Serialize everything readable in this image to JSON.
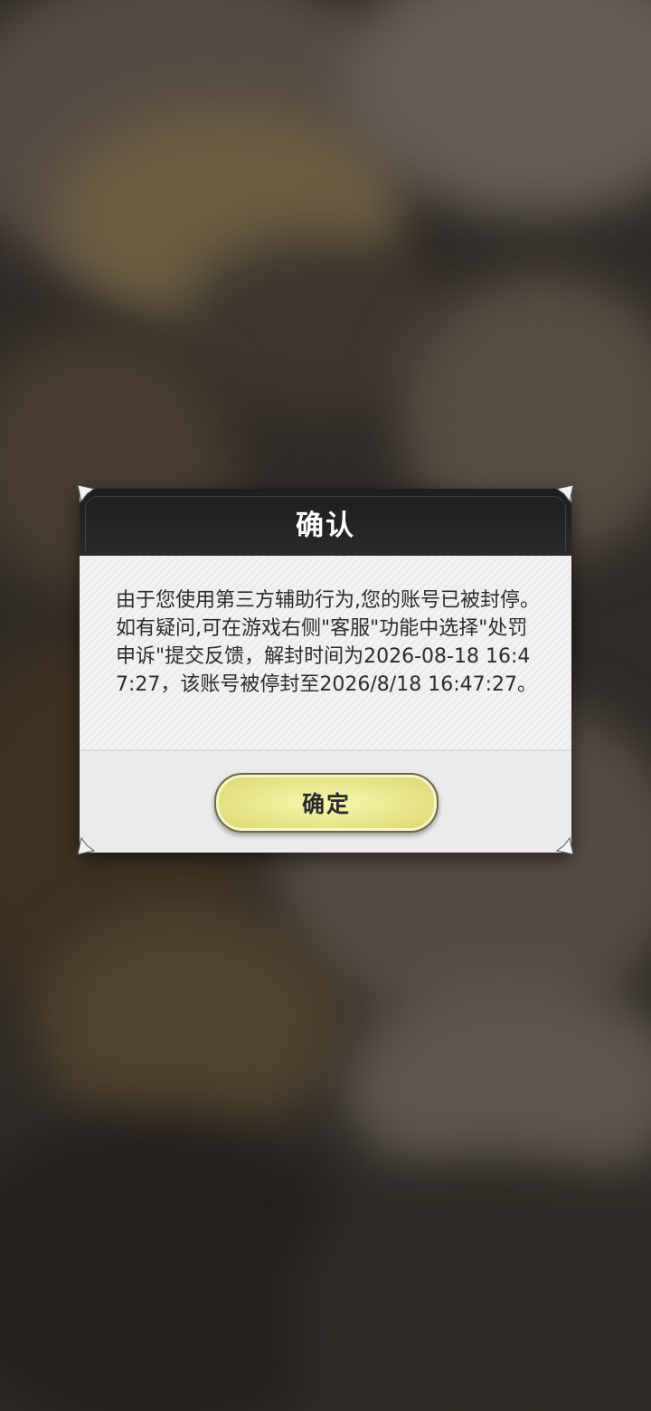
{
  "dialog": {
    "title": "确认",
    "message": "由于您使用第三方辅助行为,您的账号已被封停。如有疑问,可在游戏右侧\"客服\"功能中选择\"处罚申诉\"提交反馈，解封时间为2026-08-18 16:47:27，该账号被停封至2026/8/18 16:47:27。",
    "confirm_label": "确定"
  },
  "colors": {
    "header": "#1d1d1d",
    "panel": "#ebebeb",
    "button": "#e8e68a",
    "text": "#2c2c2c"
  },
  "icons": {
    "corner": "diamond-corner-ornament"
  }
}
